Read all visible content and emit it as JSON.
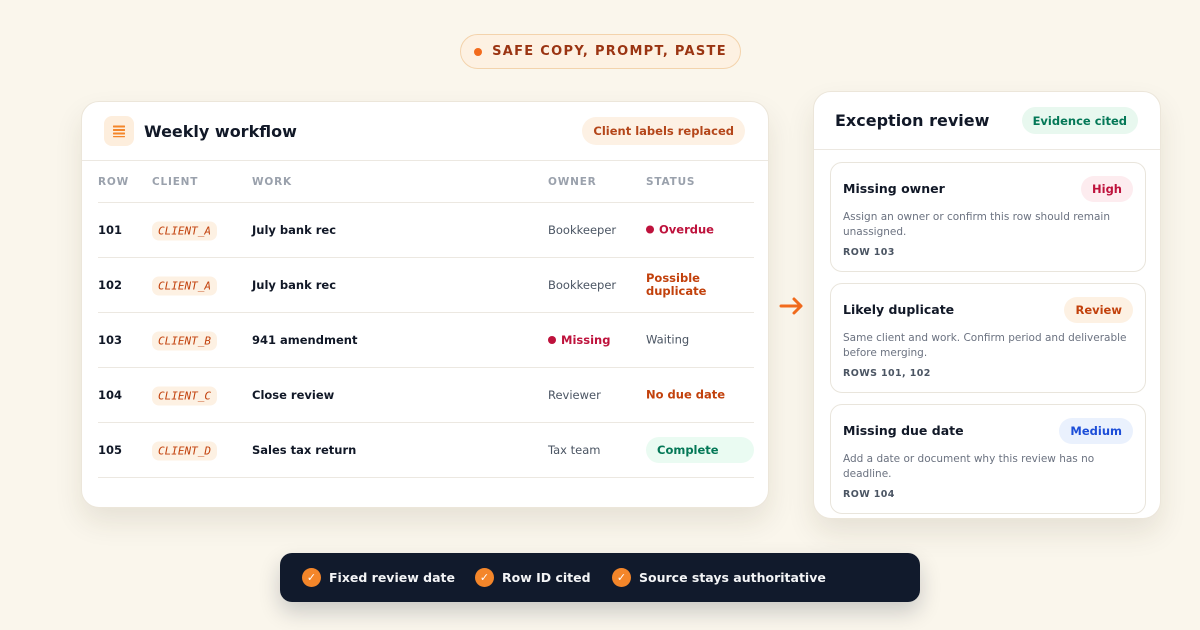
{
  "banner": {
    "label": "SAFE COPY, PROMPT, PASTE"
  },
  "workflow": {
    "title": "Weekly workflow",
    "badge": "Client labels replaced",
    "columns": [
      "ROW",
      "CLIENT",
      "WORK",
      "OWNER",
      "STATUS"
    ],
    "rows": [
      {
        "row": "101",
        "client": "CLIENT_A",
        "work": "July bank rec",
        "owner": "Bookkeeper",
        "status": "Overdue"
      },
      {
        "row": "102",
        "client": "CLIENT_A",
        "work": "July bank rec",
        "owner": "Bookkeeper",
        "status": "Possible duplicate",
        "status_line1": "Possible",
        "status_line2": "duplicate"
      },
      {
        "row": "103",
        "client": "CLIENT_B",
        "work": "941 amendment",
        "owner": "Missing",
        "status": "Waiting"
      },
      {
        "row": "104",
        "client": "CLIENT_C",
        "work": "Close review",
        "owner": "Reviewer",
        "status": "No due date"
      },
      {
        "row": "105",
        "client": "CLIENT_D",
        "work": "Sales tax return",
        "owner": "Tax team",
        "status": "Complete"
      }
    ]
  },
  "exceptions": {
    "title": "Exception review",
    "badge": "Evidence cited",
    "items": [
      {
        "title": "Missing owner",
        "severity": "High",
        "description": "Assign an owner or confirm this row should remain unassigned.",
        "ref": "ROW 103"
      },
      {
        "title": "Likely duplicate",
        "severity": "Review",
        "description": "Same client and work. Confirm period and deliverable before merging.",
        "ref": "ROWS 101, 102"
      },
      {
        "title": "Missing due date",
        "severity": "Medium",
        "description": "Add a date or document why this review has no deadline.",
        "ref": "ROW 104"
      }
    ]
  },
  "footer": {
    "items": [
      "Fixed review date",
      "Row ID cited",
      "Source stays authoritative"
    ]
  },
  "colors": {
    "accent": "#f26b1d",
    "danger": "#be123c",
    "warning": "#c2410c",
    "success": "#047857",
    "info": "#1d4ed8",
    "footer_bg": "#111a2c",
    "page_bg": "#faf6ec"
  },
  "icons": {
    "banner": "dot-icon",
    "workflow": "table-icon",
    "transition": "arrow-right-icon",
    "footer": "check-icon"
  }
}
